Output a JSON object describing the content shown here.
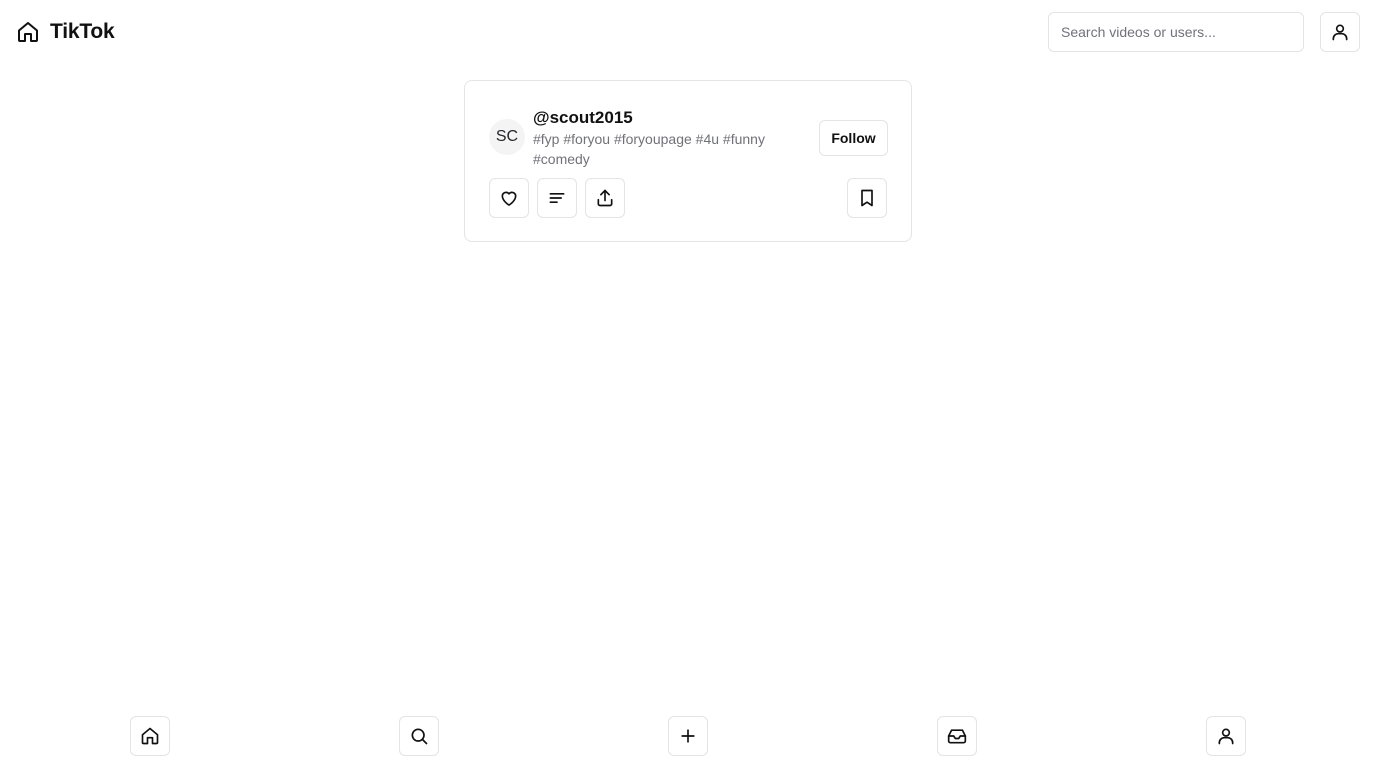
{
  "app": {
    "title": "TikTok",
    "logo_icon": "home-icon"
  },
  "search": {
    "placeholder": "Search videos or users...",
    "value": ""
  },
  "header": {
    "profile_icon": "user-icon"
  },
  "post": {
    "avatar_initials": "SC",
    "username": "@scout2015",
    "caption": "#fyp #foryou #foryoupage #4u #funny #comedy",
    "follow_label": "Follow",
    "actions": [
      "heart-icon",
      "comment-icon",
      "share-icon",
      "bookmark-icon"
    ]
  },
  "bottom_nav": {
    "items": [
      "home-icon",
      "search-icon",
      "plus-icon",
      "inbox-icon",
      "user-icon"
    ]
  }
}
